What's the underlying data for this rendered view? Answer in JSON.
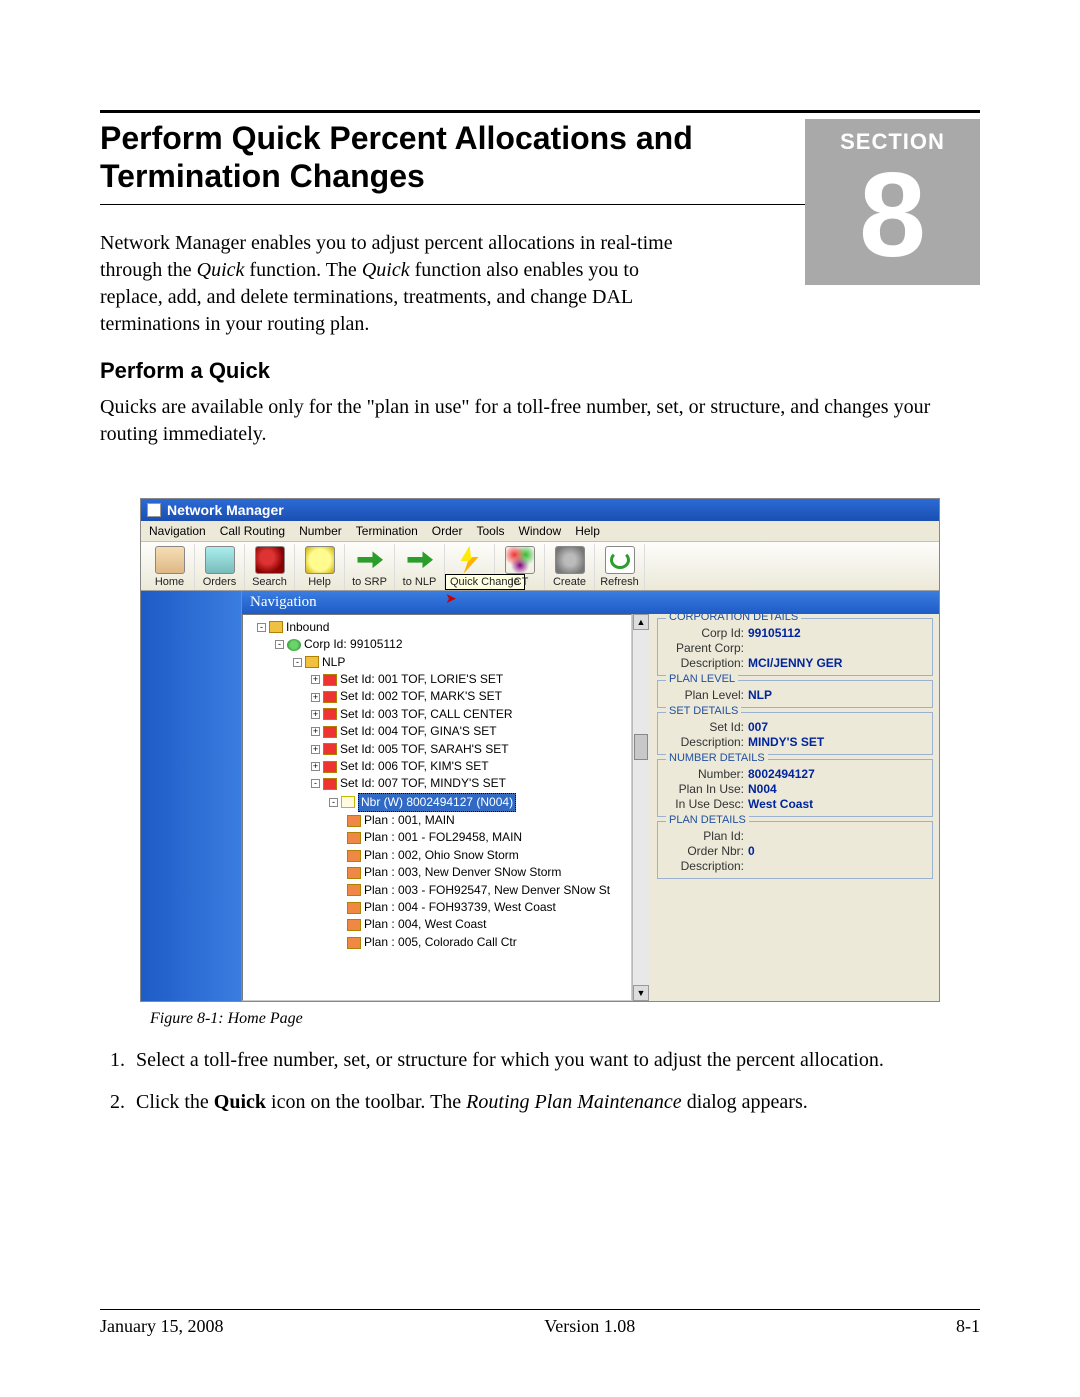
{
  "doc": {
    "title": "Perform Quick Percent Allocations and Termination Changes",
    "section_label": "SECTION",
    "section_number": "8",
    "intro_a": "Network Manager enables you to adjust percent allocations in real-time through the ",
    "intro_quick": "Quick",
    "intro_b": " function. The ",
    "intro_c": " function also enables you to replace, add, and delete terminations, treatments, and change DAL terminations in your routing plan.",
    "subhead": "Perform a Quick",
    "body": "Quicks are available only for the \"plan in use\" for a toll-free number, set, or structure, and changes your routing immediately.",
    "caption": "Figure 8-1:   Home Page",
    "step1": "Select a toll-free number, set, or structure for which you want to adjust the percent allocation.",
    "step2_a": "Click the ",
    "step2_bold": "Quick",
    "step2_b": " icon on the toolbar. The ",
    "step2_ital": "Routing Plan Maintenance",
    "step2_c": " dialog appears.",
    "footer_date": "January 15, 2008",
    "footer_ver": "Version 1.08",
    "footer_pg": "8-1"
  },
  "app": {
    "title": "Network Manager",
    "menus": [
      "Navigation",
      "Call Routing",
      "Number",
      "Termination",
      "Order",
      "Tools",
      "Window",
      "Help"
    ],
    "toolbar": [
      {
        "label": "Home",
        "icon": "home"
      },
      {
        "label": "Orders",
        "icon": "orders"
      },
      {
        "label": "Search",
        "icon": "search"
      },
      {
        "label": "Help",
        "icon": "help"
      },
      {
        "label": "to SRP",
        "icon": "arrow"
      },
      {
        "label": "to NLP",
        "icon": "arrow"
      },
      {
        "label": "Quick",
        "icon": "quick",
        "tooltip": "Quick Change",
        "pointer": true
      },
      {
        "label": "ICT",
        "icon": "ict"
      },
      {
        "label": "Create",
        "icon": "create"
      },
      {
        "label": "Refresh",
        "icon": "refresh"
      }
    ],
    "nav_head": "Navigation",
    "tree": {
      "inbound": "Inbound",
      "corp": "Corp Id: 99105112",
      "nlp": "NLP",
      "sets": [
        "Set Id:  001 TOF, LORIE'S SET",
        "Set Id:  002 TOF, MARK'S SET",
        "Set Id:  003 TOF, CALL CENTER",
        "Set Id:  004 TOF, GINA'S SET",
        "Set Id:  005 TOF, SARAH'S SET",
        "Set Id:  006 TOF, KIM'S SET",
        "Set Id:  007 TOF, MINDY'S SET"
      ],
      "selected": "Nbr (W) 8002494127 (N004)",
      "plans": [
        "Plan : 001, MAIN",
        "Plan : 001 - FOL29458, MAIN",
        "Plan : 002, Ohio Snow Storm",
        "Plan : 003, New Denver SNow Storm",
        "Plan : 003 - FOH92547, New Denver SNow St",
        "Plan : 004 - FOH93739, West Coast",
        "Plan : 004, West Coast",
        "Plan : 005, Colorado Call Ctr"
      ]
    },
    "details": {
      "corp": {
        "title": "CORPORATION DETAILS",
        "corp_id_lbl": "Corp Id:",
        "corp_id": "99105112",
        "parent_lbl": "Parent Corp:",
        "parent": "",
        "desc_lbl": "Description:",
        "desc": "MCI/JENNY GER"
      },
      "plan_level": {
        "title": "PLAN LEVEL",
        "lbl": "Plan Level:",
        "val": "NLP"
      },
      "set": {
        "title": "SET DETAILS",
        "id_lbl": "Set Id:",
        "id": "007",
        "desc_lbl": "Description:",
        "desc": "MINDY'S SET"
      },
      "number": {
        "title": "NUMBER DETAILS",
        "num_lbl": "Number:",
        "num": "8002494127",
        "piu_lbl": "Plan In Use:",
        "piu": "N004",
        "iud_lbl": "In Use Desc:",
        "iud": "West Coast"
      },
      "plan": {
        "title": "PLAN DETAILS",
        "id_lbl": "Plan Id:",
        "id": "",
        "ord_lbl": "Order Nbr:",
        "ord": "0",
        "desc_lbl": "Description:",
        "desc": ""
      }
    }
  }
}
